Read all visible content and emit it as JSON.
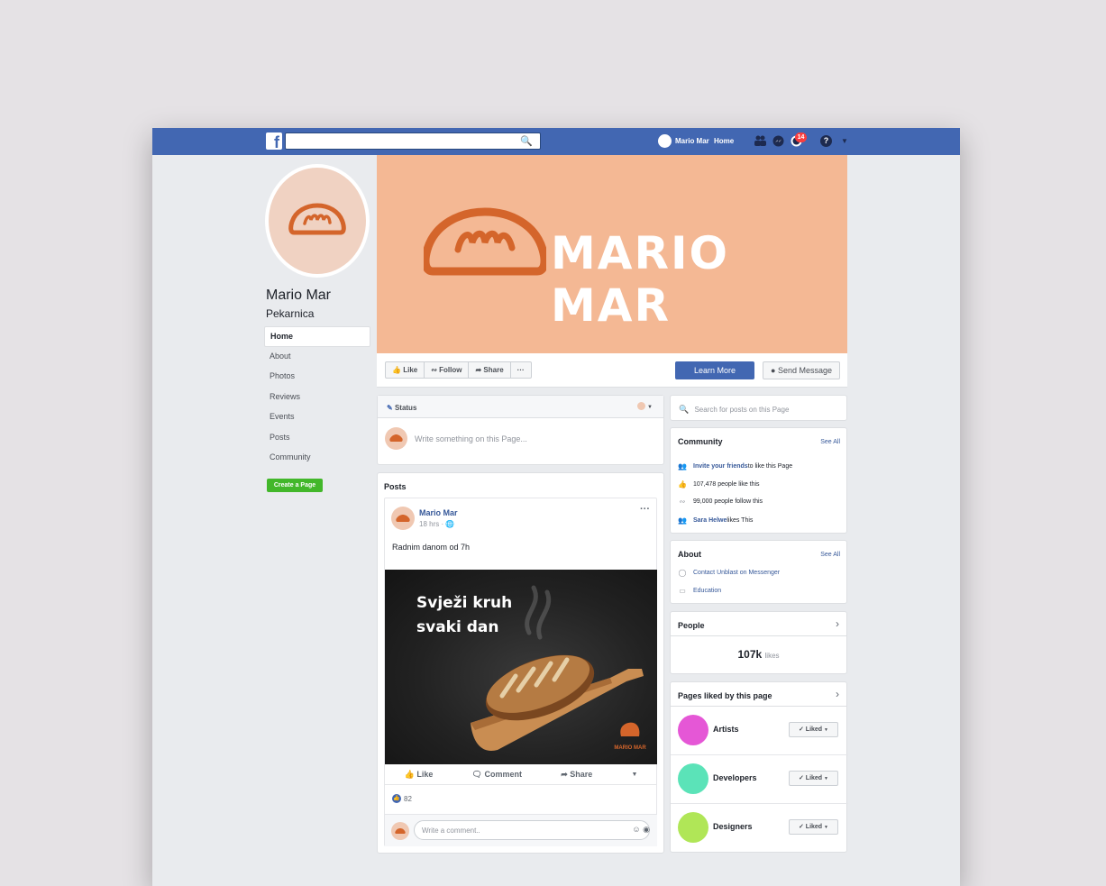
{
  "topbar": {
    "search_icon": "magnifier-icon",
    "user_name": "Mario Mar",
    "home_label": "Home",
    "notification_count": "14",
    "help_label": "?"
  },
  "page": {
    "name": "Mario Mar",
    "category": "Pekarnica",
    "cover_title": "MARIO MAR",
    "nav": [
      "Home",
      "About",
      "Photos",
      "Reviews",
      "Events",
      "Posts",
      "Community"
    ],
    "create_page": "Create a Page"
  },
  "actions": {
    "like": "Like",
    "follow": "Follow",
    "share": "Share",
    "more": "···",
    "learn_more": "Learn More",
    "send_message": "Send Message"
  },
  "composer": {
    "status_label": "Status",
    "placeholder": "Write something on this Page..."
  },
  "posts": {
    "title": "Posts",
    "author": "Mario Mar",
    "time": "18 hrs",
    "text": "Radnim danom od 7h",
    "image_line1": "Svježi kruh",
    "image_line2": "svaki dan",
    "image_brand": "MARIO MAR",
    "like": "Like",
    "comment": "Comment",
    "share": "Share",
    "reactions": "82",
    "comment_placeholder": "Write a comment.."
  },
  "sidebar": {
    "search_placeholder": "Search for posts on this Page",
    "community_title": "Community",
    "see_all": "See All",
    "invite_link": "Invite your friends",
    "invite_rest": " to like this Page",
    "likes_text": "107,478 people like this",
    "follow_text": "99,000 people follow this",
    "friend_name": "Sara Helwe",
    "friend_rest": " likes This",
    "about_title": "About",
    "contact": "Contact Unblast on Messenger",
    "education": "Education",
    "people_title": "People",
    "likes_count": "107k",
    "likes_label": "likes",
    "pages_liked_title": "Pages liked by this page",
    "pages_liked": [
      {
        "name": "Artists",
        "button": "Liked",
        "color": "#e557d6"
      },
      {
        "name": "Developers",
        "button": "Liked",
        "color": "#5be3b8"
      },
      {
        "name": "Designers",
        "button": "Liked",
        "color": "#b0e657"
      }
    ]
  },
  "colors": {
    "brand_blue": "#4267b2",
    "cover_peach": "#f4b894",
    "logo_orange": "#d4652b",
    "create_green": "#42b72a"
  }
}
